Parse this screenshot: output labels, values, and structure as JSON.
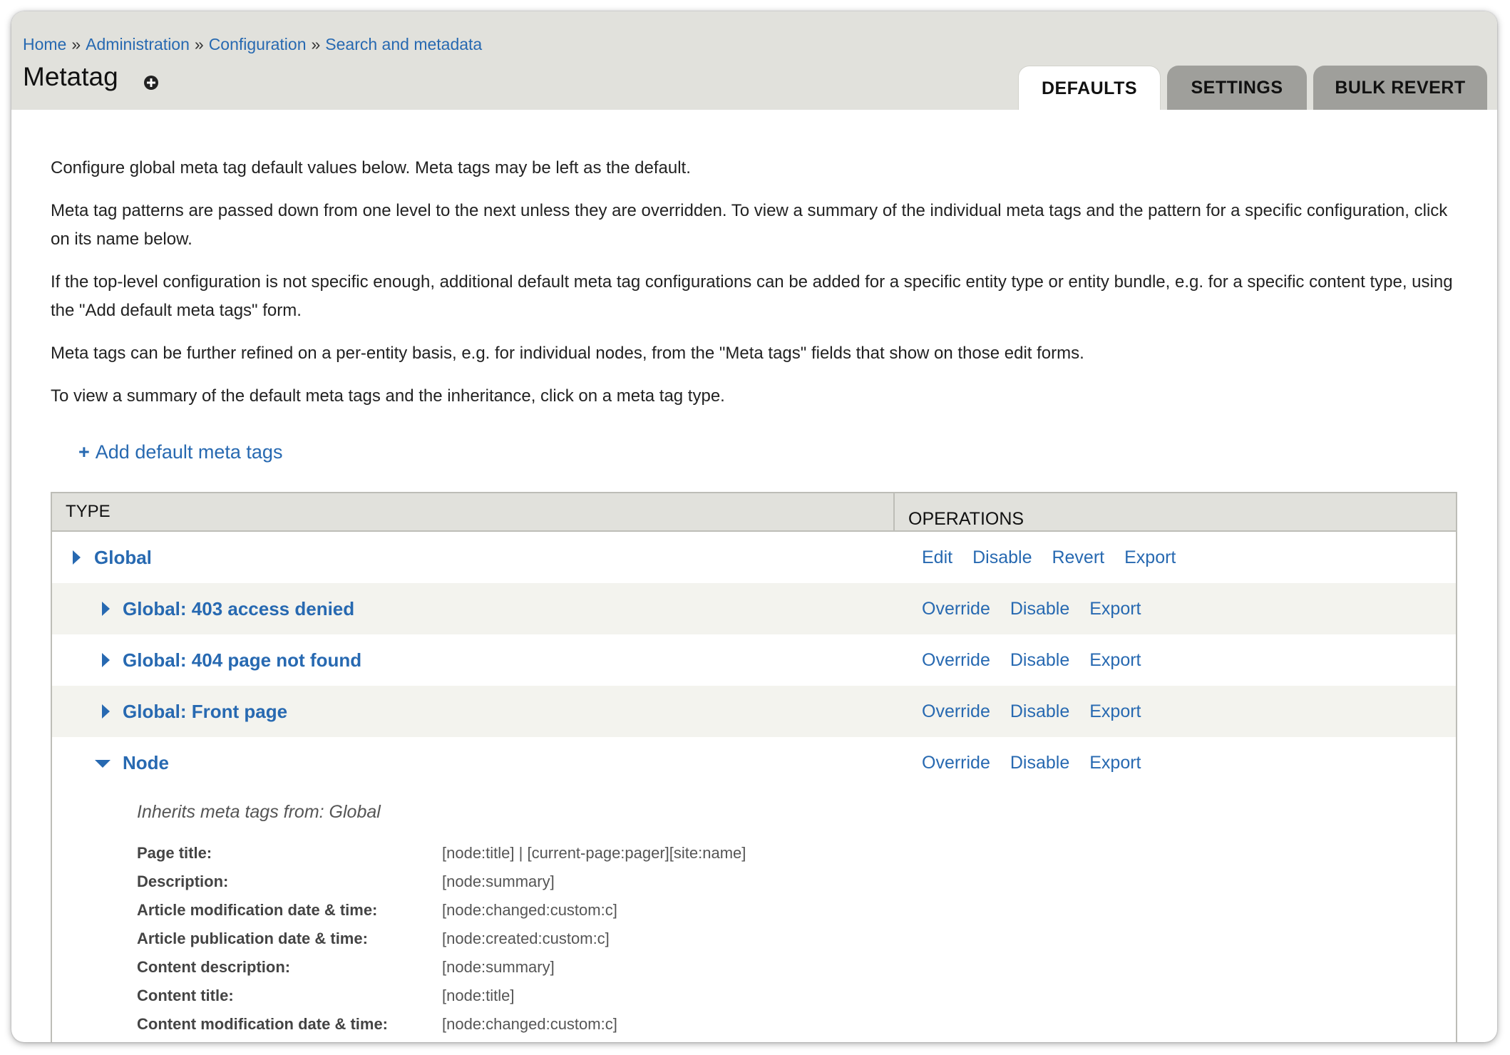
{
  "breadcrumb": {
    "items": [
      "Home",
      "Administration",
      "Configuration",
      "Search and metadata"
    ],
    "separator": "»"
  },
  "page_title": "Metatag",
  "tabs": [
    {
      "label": "Defaults",
      "active": true
    },
    {
      "label": "Settings",
      "active": false
    },
    {
      "label": "Bulk revert",
      "active": false
    }
  ],
  "intro": [
    "Configure global meta tag default values below. Meta tags may be left as the default.",
    "Meta tag patterns are passed down from one level to the next unless they are overridden. To view a summary of the individual meta tags and the pattern for a specific configuration, click on its name below.",
    "If the top-level configuration is not specific enough, additional default meta tag configurations can be added for a specific entity type or entity bundle, e.g. for a specific content type, using the \"Add default meta tags\" form.",
    "Meta tags can be further refined on a per-entity basis, e.g. for individual nodes, from the \"Meta tags\" fields that show on those edit forms.",
    "To view a summary of the default meta tags and the inheritance, click on a meta tag type."
  ],
  "add_link": {
    "icon": "+",
    "label": "Add default meta tags"
  },
  "table": {
    "headers": {
      "type": "Type",
      "operations": "Operations"
    },
    "rows": [
      {
        "name": "Global",
        "expanded": false,
        "operations": [
          "Edit",
          "Disable",
          "Revert",
          "Export"
        ]
      },
      {
        "name": "Global: 403 access denied",
        "expanded": false,
        "operations": [
          "Override",
          "Disable",
          "Export"
        ]
      },
      {
        "name": "Global: 404 page not found",
        "expanded": false,
        "operations": [
          "Override",
          "Disable",
          "Export"
        ]
      },
      {
        "name": "Global: Front page",
        "expanded": false,
        "operations": [
          "Override",
          "Disable",
          "Export"
        ]
      },
      {
        "name": "Node",
        "expanded": true,
        "operations": [
          "Override",
          "Disable",
          "Export"
        ]
      }
    ],
    "node_detail": {
      "inherits": "Inherits meta tags from: Global",
      "tags": [
        {
          "label": "Page title:",
          "value": "[node:title] | [current-page:pager][site:name]"
        },
        {
          "label": "Description:",
          "value": "[node:summary]"
        },
        {
          "label": "Article modification date & time:",
          "value": "[node:changed:custom:c]"
        },
        {
          "label": "Article publication date & time:",
          "value": "[node:created:custom:c]"
        },
        {
          "label": "Content description:",
          "value": "[node:summary]"
        },
        {
          "label": "Content title:",
          "value": "[node:title]"
        },
        {
          "label": "Content modification date & time:",
          "value": "[node:changed:custom:c]"
        }
      ]
    }
  },
  "colors": {
    "link": "#2769b1",
    "header_bg": "#e1e1dc",
    "stripe_bg": "#f3f3ee"
  }
}
